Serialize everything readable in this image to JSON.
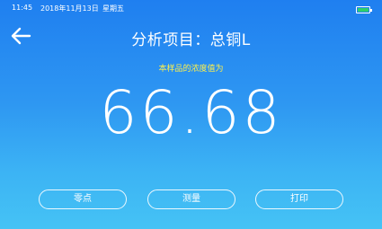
{
  "status": {
    "time": "11:45",
    "date": "2018年11月13日",
    "weekday": "星期五",
    "battery_icon": "battery-icon",
    "battery_color": "#2ed06a"
  },
  "header": {
    "back_icon": "arrow-left-icon",
    "title": "分析项目：总铜L"
  },
  "result": {
    "label": "本样品的浓度值为",
    "value": "66.68",
    "label_color": "#fff04a"
  },
  "buttons": {
    "zero": "零点",
    "measure": "测量",
    "print": "打印"
  }
}
